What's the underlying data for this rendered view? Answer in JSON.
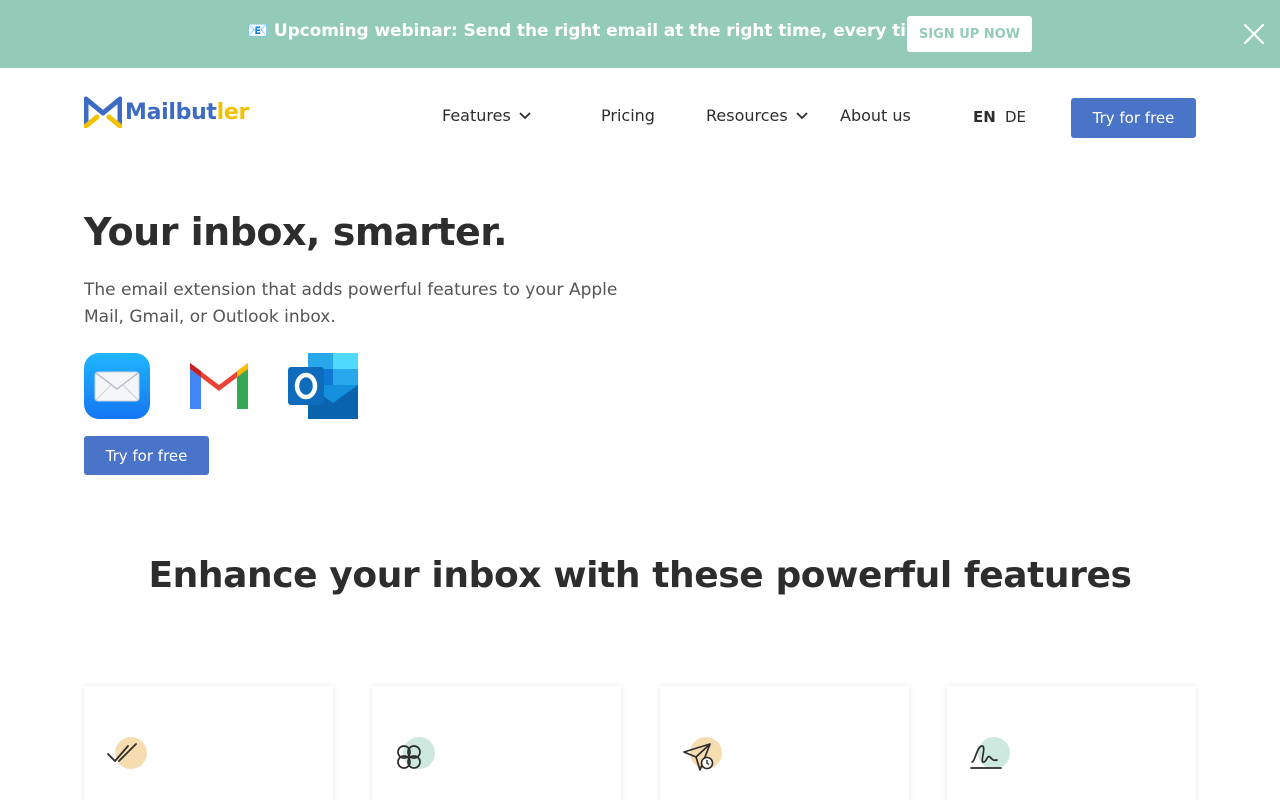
{
  "banner": {
    "text": "📧 Upcoming webinar: Send the right email at the right time, every time",
    "cta": "SIGN UP NOW",
    "close_icon": "close-icon"
  },
  "header": {
    "logo_main": "Mailbut",
    "logo_tail": "ler",
    "nav": {
      "features": "Features",
      "pricing": "Pricing",
      "resources": "Resources",
      "about": "About us"
    },
    "lang": {
      "en": "EN",
      "de": "DE",
      "active": "EN"
    },
    "cta": "Try for free"
  },
  "hero": {
    "title": "Your inbox, smarter.",
    "subtitle": "The email extension that adds powerful features to your Apple Mail, Gmail, or Outlook inbox.",
    "apps": [
      "apple-mail-icon",
      "gmail-icon",
      "outlook-icon"
    ],
    "cta": "Try for free"
  },
  "features": {
    "title": "Enhance your inbox with these powerful features",
    "cards": [
      {
        "icon": "double-check-icon",
        "accent": "#f6ddb0"
      },
      {
        "icon": "clover-icon",
        "accent": "#cde8de"
      },
      {
        "icon": "send-later-icon",
        "accent": "#f6ddb0"
      },
      {
        "icon": "signature-icon",
        "accent": "#cde8de"
      }
    ]
  },
  "colors": {
    "banner": "#93cbb8",
    "primary": "#4a74c7",
    "text": "#2d2d2d"
  }
}
